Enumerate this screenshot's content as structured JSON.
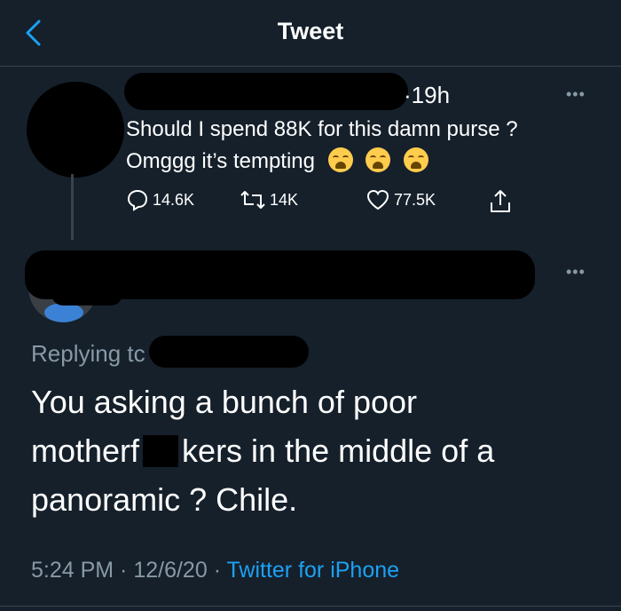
{
  "header": {
    "title": "Tweet"
  },
  "parent_tweet": {
    "time": "19h",
    "text_line1": "Should I spend 88K for this damn purse ?",
    "text_line2": "Omggg it’s tempting",
    "actions": {
      "replies": "14.6K",
      "retweets": "14K",
      "likes": "77.5K"
    }
  },
  "reply_tweet": {
    "replying_to": "Replying tc",
    "text_part1": "You asking a bunch of poor",
    "text_part2": "motherf",
    "text_part3": "kers in the middle of a",
    "text_part4": "panoramic ? Chile.",
    "time": "5:24 PM",
    "date": "12/6/20",
    "source": "Twitter for iPhone",
    "separator": " · "
  },
  "more_label": "•••",
  "colors": {
    "background": "#15202b",
    "accent": "#1da1f2",
    "muted": "#8899a6",
    "divider": "#38444d"
  }
}
